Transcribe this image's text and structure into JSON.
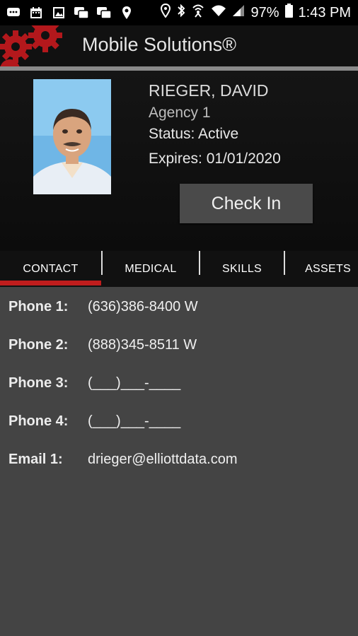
{
  "status_bar": {
    "battery": "97%",
    "time": "1:43 PM",
    "icons": [
      "message-icon",
      "calendar-icon",
      "image-icon",
      "voicemail-icon",
      "voicemail-icon",
      "location-icon",
      "location-icon",
      "bluetooth-icon",
      "hotspot-icon",
      "wifi-icon",
      "signal-icon",
      "battery-icon"
    ]
  },
  "app_bar": {
    "title": "Mobile Solutions®",
    "logo": "gears-logo"
  },
  "profile": {
    "name": "RIEGER, DAVID",
    "agency": "Agency 1",
    "status": "Status: Active",
    "expires": "Expires: 01/01/2020",
    "check_in_label": "Check In"
  },
  "tabs": [
    {
      "label": "CONTACT",
      "selected": true
    },
    {
      "label": "MEDICAL",
      "selected": false
    },
    {
      "label": "SKILLS",
      "selected": false
    },
    {
      "label": "ASSETS",
      "selected": false
    }
  ],
  "contact": [
    {
      "label": "Phone 1:",
      "value": "(636)386-8400 W"
    },
    {
      "label": "Phone 2:",
      "value": "(888)345-8511 W"
    },
    {
      "label": "Phone 3:",
      "value": "(___)___-____"
    },
    {
      "label": "Phone 4:",
      "value": "(___)___-____"
    },
    {
      "label": "Email 1:",
      "value": "drieger@elliottdata.com"
    }
  ],
  "colors": {
    "accent": "#c01d1d",
    "background": "#444444"
  }
}
